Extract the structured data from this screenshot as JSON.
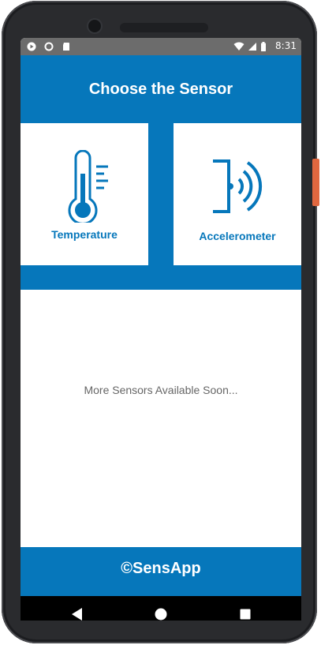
{
  "status_bar": {
    "time": "8:31",
    "left_icons": [
      "play-store-icon",
      "circle-notification-icon",
      "sd-card-icon"
    ],
    "right_icons": [
      "wifi-icon",
      "signal-icon",
      "battery-icon"
    ]
  },
  "app": {
    "title": "Choose the Sensor",
    "accent_color": "#0677bb"
  },
  "sensors": [
    {
      "label": "Temperature",
      "icon": "thermometer-icon"
    },
    {
      "label": "Accelerometer",
      "icon": "proximity-signal-icon"
    }
  ],
  "main": {
    "message": "More Sensors Available Soon..."
  },
  "footer": {
    "text": "©SensApp"
  },
  "nav_bar": {
    "buttons": [
      "back-icon",
      "home-icon",
      "recents-icon"
    ]
  }
}
